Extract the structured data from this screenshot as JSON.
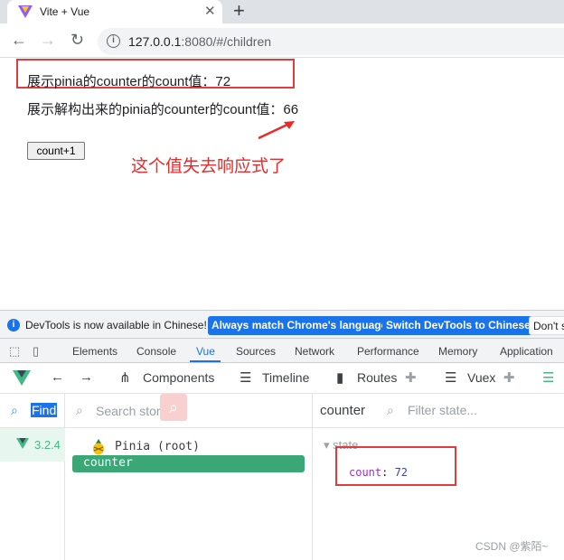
{
  "browser": {
    "tab_title": "Vite + Vue",
    "close_glyph": "✕",
    "new_tab_glyph": "+",
    "back_glyph": "←",
    "forward_glyph": "→",
    "reload_glyph": "↻",
    "info_glyph": "i",
    "url_host": "127.0.0.1",
    "url_rest": ":8080/#/children"
  },
  "page": {
    "line1": "展示pinia的counter的count值：72",
    "line2": "展示解构出来的pinia的counter的count值：66",
    "button_label": "count+1",
    "annotation": "这个值失去响应式了",
    "highlight_color": "#e03c3c"
  },
  "devtools": {
    "infobar": {
      "icon": "i",
      "text": "DevTools is now available in Chinese!",
      "btn_match": "Always match Chrome's language",
      "btn_switch": "Switch DevTools to Chinese",
      "btn_dont": "Don't s"
    },
    "tabs": [
      "Elements",
      "Console",
      "Vue",
      "Sources",
      "Network",
      "Performance",
      "Memory",
      "Application"
    ],
    "active_tab": "Vue",
    "vue_nav": {
      "back": "←",
      "forward": "→",
      "components": "Components",
      "timeline": "Timeline",
      "routes": "Routes",
      "vuex": "Vuex"
    },
    "apps": {
      "find_label": "Find",
      "version": "3.2.4"
    },
    "stores": {
      "search_placeholder": "Search stores",
      "root": "Pinia (root)",
      "selected": "counter"
    },
    "state": {
      "store_name": "counter",
      "filter_placeholder": "Filter state...",
      "section": "state",
      "key": "count",
      "separator": ": ",
      "value": "72"
    },
    "watermark": "CSDN @紫陌~"
  }
}
